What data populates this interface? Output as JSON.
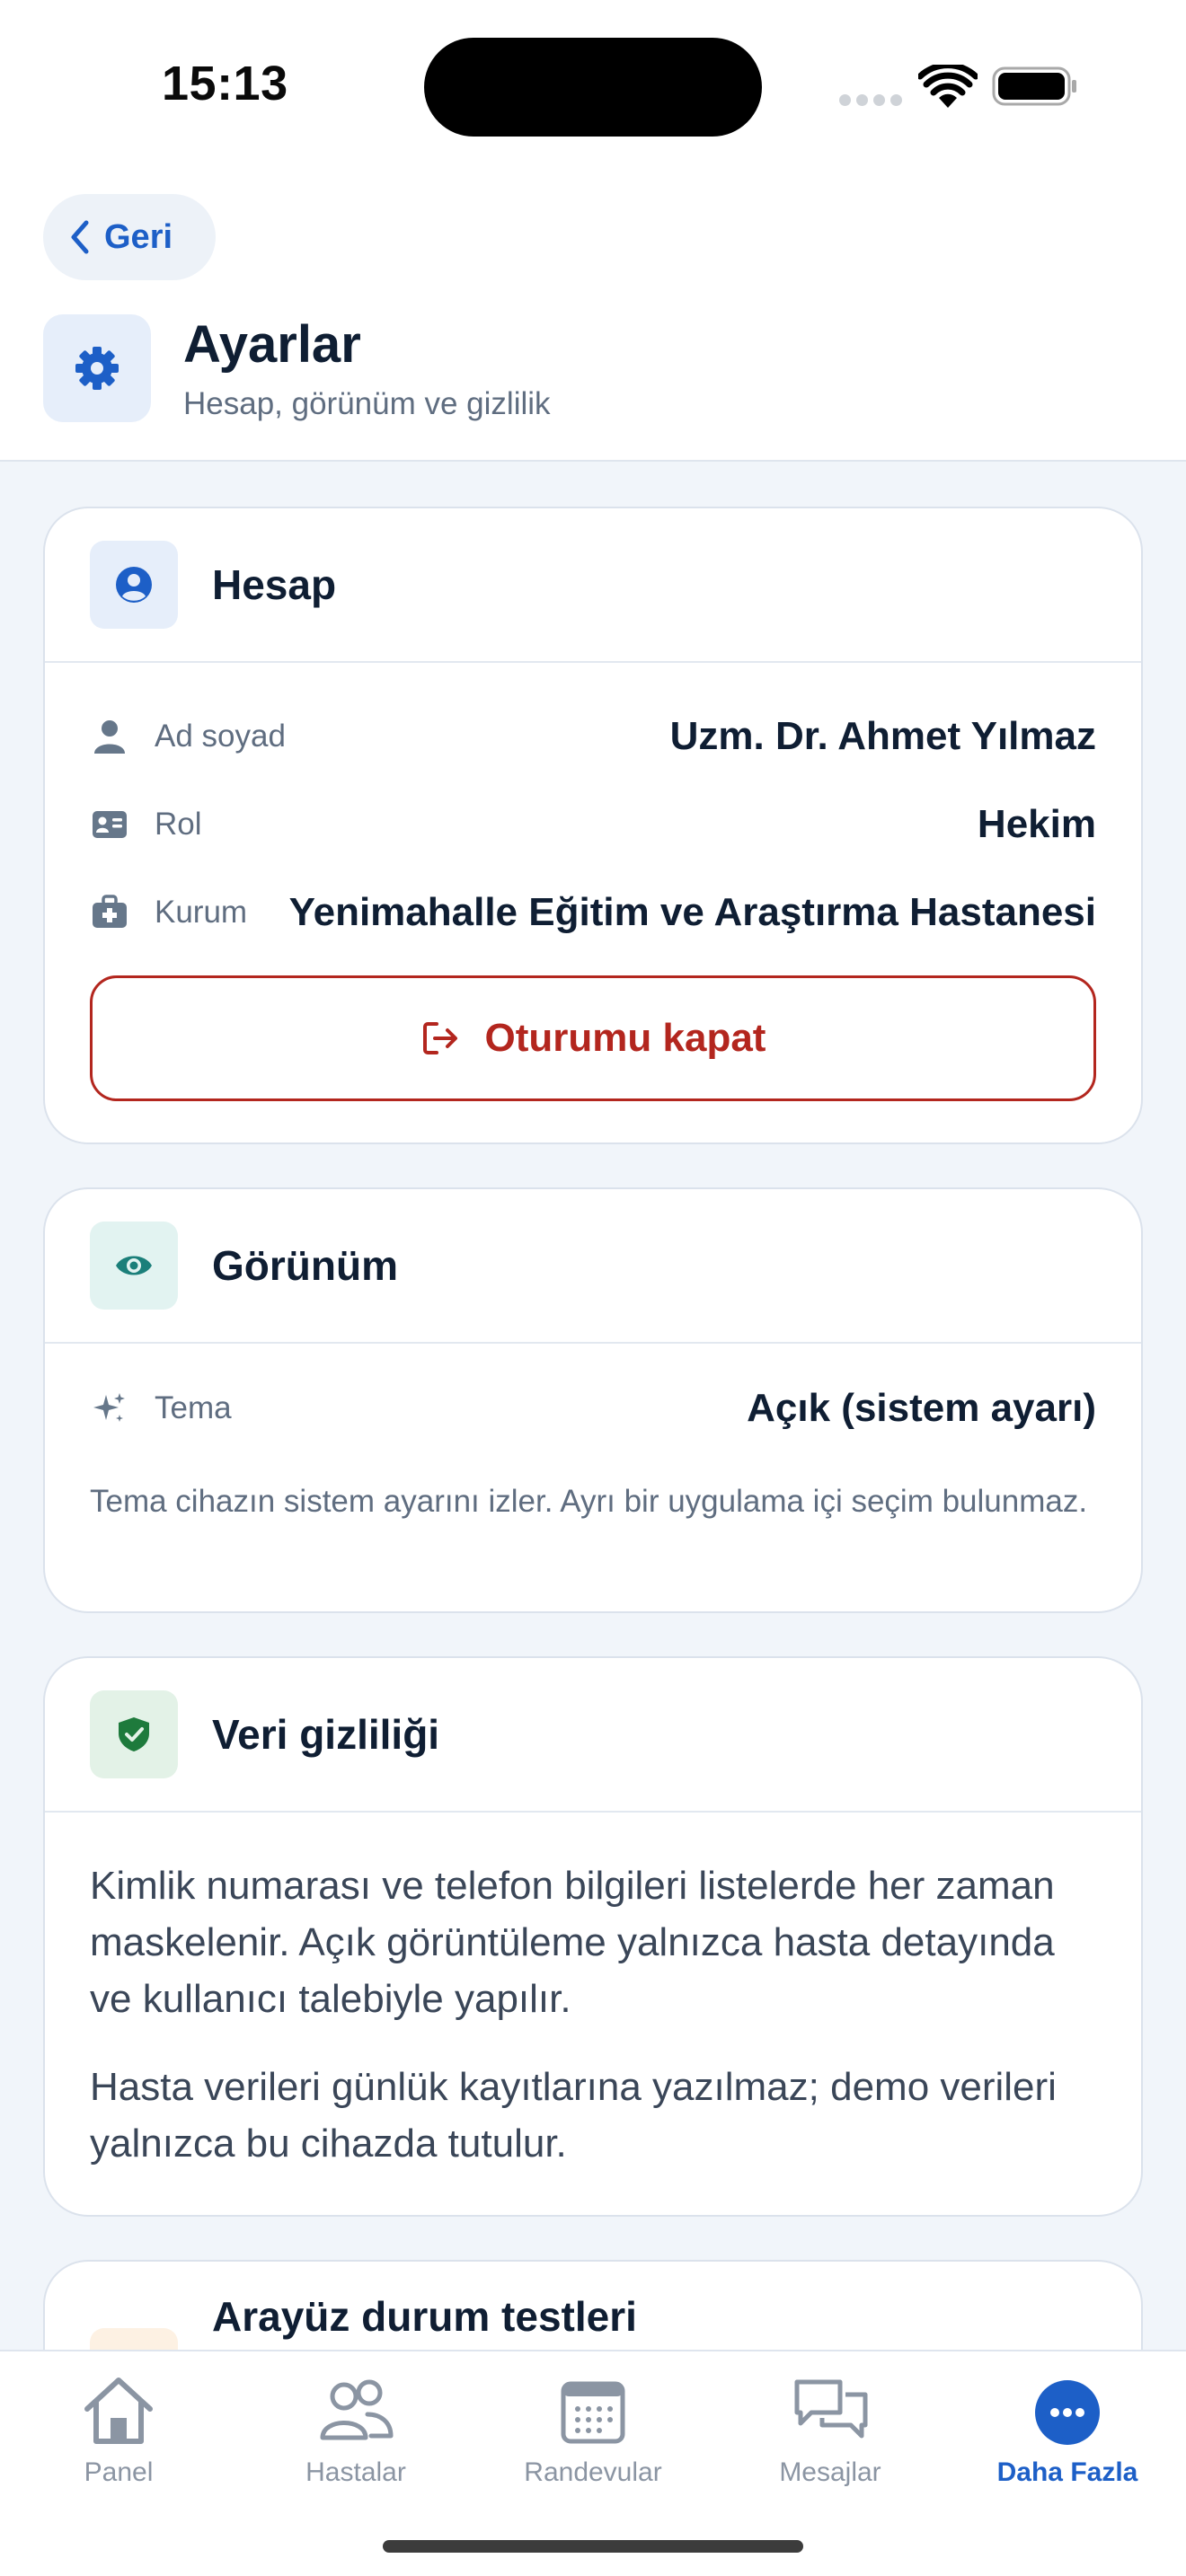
{
  "status_bar": {
    "time": "15:13"
  },
  "header": {
    "back_label": "Geri",
    "title": "Ayarlar",
    "subtitle": "Hesap, görünüm ve gizlilik"
  },
  "account": {
    "title": "Hesap",
    "rows": [
      {
        "label": "Ad soyad",
        "value": "Uzm. Dr. Ahmet Yılmaz",
        "icon": "person-icon"
      },
      {
        "label": "Rol",
        "value": "Hekim",
        "icon": "id-card-icon"
      },
      {
        "label": "Kurum",
        "value": "Yenimahalle Eğitim ve Araştırma Hastanesi",
        "icon": "medical-bag-icon"
      }
    ],
    "logout_label": "Oturumu kapat"
  },
  "appearance": {
    "title": "Görünüm",
    "theme_label": "Tema",
    "theme_value": "Açık (sistem ayarı)",
    "note": "Tema cihazın sistem ayarını izler. Ayrı bir uygulama içi seçim bulunmaz."
  },
  "privacy": {
    "title": "Veri gizliliği",
    "paragraph1": "Kimlik numarası ve telefon bilgileri listelerde her zaman maskelenir. Açık görüntüleme yalnızca hasta detayında ve kullanıcı talebiyle yapılır.",
    "paragraph2": "Hasta verileri günlük kayıtlarına yazılmaz; demo verileri yalnızca bu cihazda tutulur."
  },
  "ui_tests": {
    "title": "Arayüz durum testleri"
  },
  "tabs": [
    {
      "label": "Panel",
      "icon": "house-icon",
      "active": false
    },
    {
      "label": "Hastalar",
      "icon": "people-icon",
      "active": false
    },
    {
      "label": "Randevular",
      "icon": "calendar-icon",
      "active": false
    },
    {
      "label": "Mesajlar",
      "icon": "chat-bubbles-icon",
      "active": false
    },
    {
      "label": "Daha Fazla",
      "icon": "more-icon",
      "active": true
    }
  ],
  "colors": {
    "accent": "#1d5fc7",
    "danger": "#b3261e",
    "background": "#f1f5fa",
    "teal": "#1b7f7a",
    "green": "#1e7a3c",
    "muted_text": "#5f6d80"
  }
}
